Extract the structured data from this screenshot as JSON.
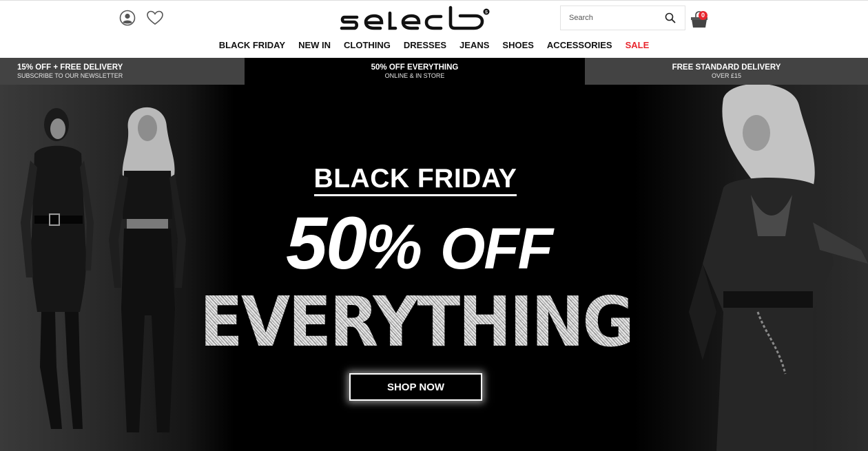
{
  "header": {
    "logo_text": "select",
    "search": {
      "placeholder": "Search"
    },
    "bag_count": "0",
    "icons": [
      "account-icon",
      "heart-icon",
      "search-icon",
      "shopping-bag-icon"
    ]
  },
  "nav": {
    "items": [
      {
        "label": "BLACK FRIDAY"
      },
      {
        "label": "NEW IN"
      },
      {
        "label": "CLOTHING"
      },
      {
        "label": "DRESSES"
      },
      {
        "label": "JEANS"
      },
      {
        "label": "SHOES"
      },
      {
        "label": "ACCESSORIES"
      },
      {
        "label": "SALE"
      }
    ]
  },
  "promo": [
    {
      "title": "15% OFF + FREE DELIVERY",
      "sub": "SUBSCRIBE TO OUR NEWSLETTER"
    },
    {
      "title": "50% OFF EVERYTHING",
      "sub": "ONLINE & IN STORE"
    },
    {
      "title": "FREE STANDARD DELIVERY",
      "sub": "OVER £15"
    }
  ],
  "hero": {
    "kicker": "BLACK FRIDAY",
    "big_number": "50",
    "big_percent": "%",
    "big_off": "OFF",
    "glitter": "EVERYTHING",
    "cta": "SHOP NOW"
  },
  "colors": {
    "sale_red": "#e8262e",
    "promo_grey": "#434343",
    "hero_black": "#000000"
  }
}
